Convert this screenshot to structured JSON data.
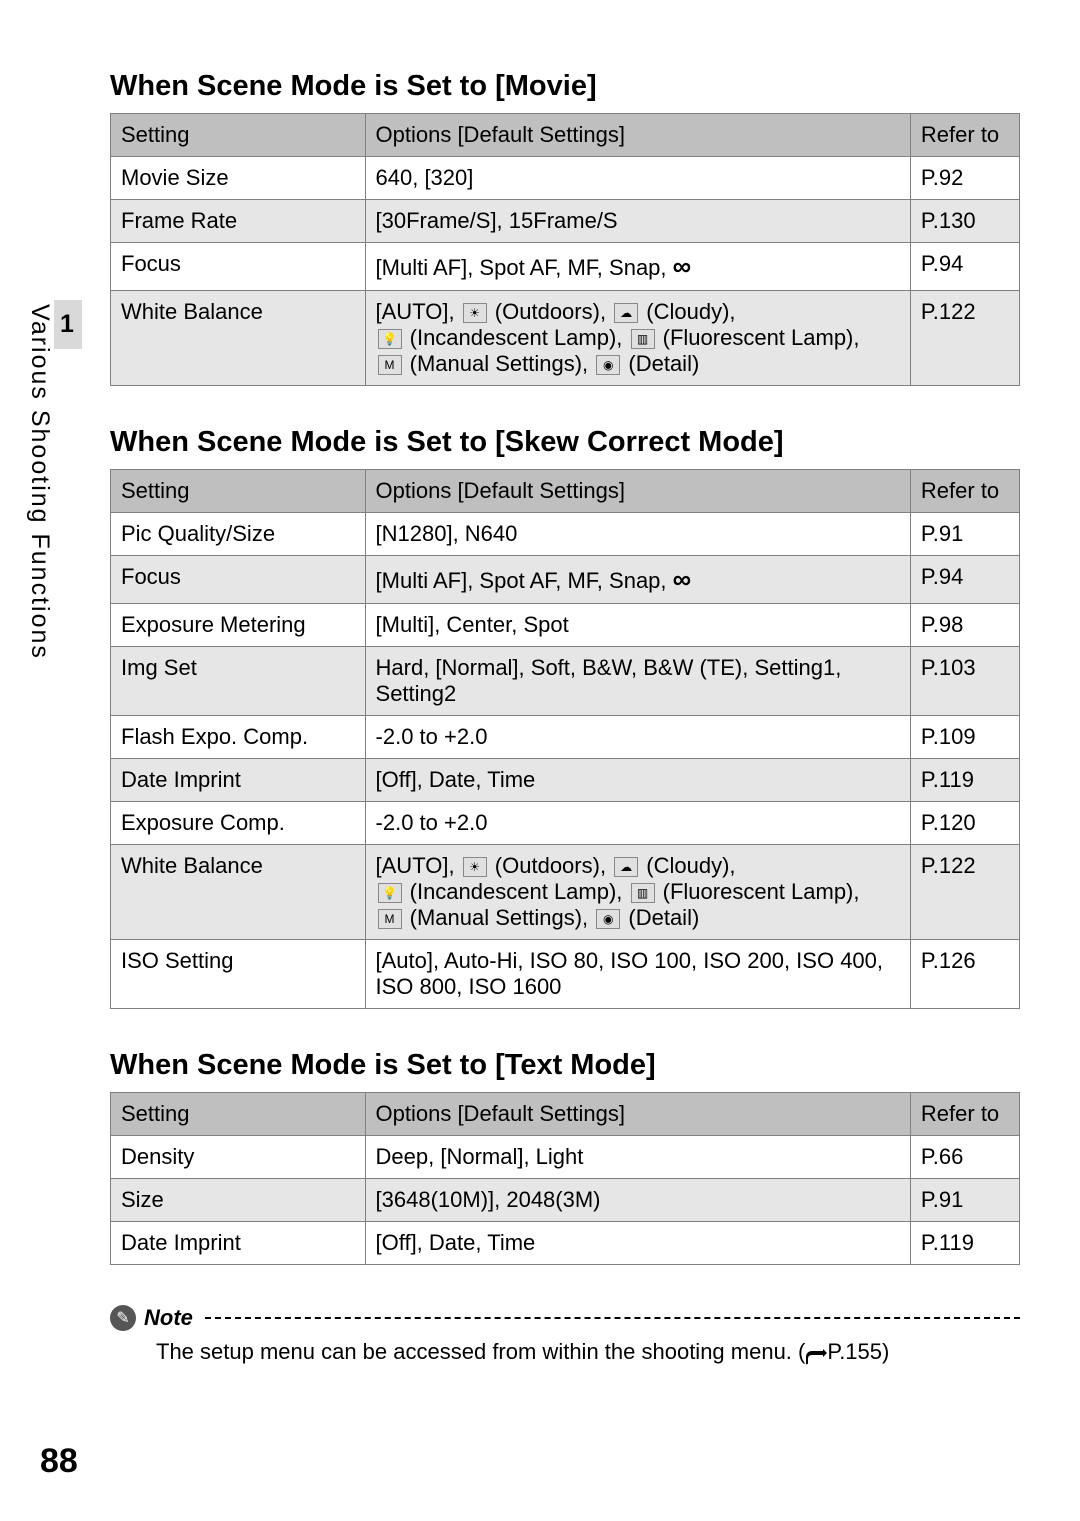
{
  "side_tab": {
    "number": "1",
    "label": "Various Shooting Functions"
  },
  "page_number": "88",
  "sections": [
    {
      "title": "When Scene Mode is Set to [Movie]",
      "headers": [
        "Setting",
        "Options [Default Settings]",
        "Refer to"
      ],
      "rows": [
        {
          "setting": "Movie Size",
          "options_plain": "640, [320]",
          "refer": "P.92",
          "shade": false
        },
        {
          "setting": "Frame Rate",
          "options_plain": "[30Frame/S], 15Frame/S",
          "refer": "P.130",
          "shade": true
        },
        {
          "setting": "Focus",
          "options_focus": {
            "prefix": "[Multi AF], Spot AF, MF, Snap, ",
            "infinity": "∞"
          },
          "refer": "P.94",
          "shade": false
        },
        {
          "setting": "White Balance",
          "options_wb": true,
          "refer": "P.122",
          "shade": true
        }
      ]
    },
    {
      "title": "When Scene Mode is Set to [Skew Correct Mode]",
      "headers": [
        "Setting",
        "Options [Default Settings]",
        "Refer to"
      ],
      "rows": [
        {
          "setting": "Pic Quality/Size",
          "options_plain": "[N1280], N640",
          "refer": "P.91",
          "shade": false
        },
        {
          "setting": "Focus",
          "options_focus": {
            "prefix": "[Multi AF], Spot AF, MF, Snap, ",
            "infinity": "∞"
          },
          "refer": "P.94",
          "shade": true
        },
        {
          "setting": "Exposure Metering",
          "options_plain": "[Multi], Center, Spot",
          "refer": "P.98",
          "shade": false
        },
        {
          "setting": "Img Set",
          "options_plain": "Hard, [Normal], Soft, B&W, B&W (TE), Setting1, Setting2",
          "refer": "P.103",
          "shade": true
        },
        {
          "setting": "Flash Expo. Comp.",
          "options_plain": "-2.0 to +2.0",
          "refer": "P.109",
          "shade": false
        },
        {
          "setting": "Date Imprint",
          "options_plain": "[Off], Date, Time",
          "refer": "P.119",
          "shade": true
        },
        {
          "setting": "Exposure Comp.",
          "options_plain": "-2.0 to +2.0",
          "refer": "P.120",
          "shade": false
        },
        {
          "setting": "White Balance",
          "options_wb": true,
          "refer": "P.122",
          "shade": true
        },
        {
          "setting": "ISO Setting",
          "options_plain": "[Auto], Auto-Hi, ISO 80, ISO 100, ISO 200, ISO 400, ISO 800, ISO 1600",
          "refer": "P.126",
          "shade": false
        }
      ]
    },
    {
      "title": "When Scene Mode is Set to [Text Mode]",
      "headers": [
        "Setting",
        "Options [Default Settings]",
        "Refer to"
      ],
      "rows": [
        {
          "setting": "Density",
          "options_plain": "Deep, [Normal], Light",
          "refer": "P.66",
          "shade": false
        },
        {
          "setting": "Size",
          "options_plain": "[3648(10M)], 2048(3M)",
          "refer": "P.91",
          "shade": true
        },
        {
          "setting": "Date Imprint",
          "options_plain": "[Off], Date, Time",
          "refer": "P.119",
          "shade": false
        }
      ]
    }
  ],
  "wb": {
    "auto": "[AUTO],",
    "outdoors": " (Outdoors), ",
    "cloudy": " (Cloudy),",
    "incandescent": " (Incandescent Lamp), ",
    "fluorescent": " (Fluorescent Lamp),",
    "manual": " (Manual Settings), ",
    "detail": " (Detail)"
  },
  "note": {
    "label": "Note",
    "text_prefix": "The setup menu can be accessed from within the shooting menu. (",
    "text_suffix": "P.155)"
  }
}
